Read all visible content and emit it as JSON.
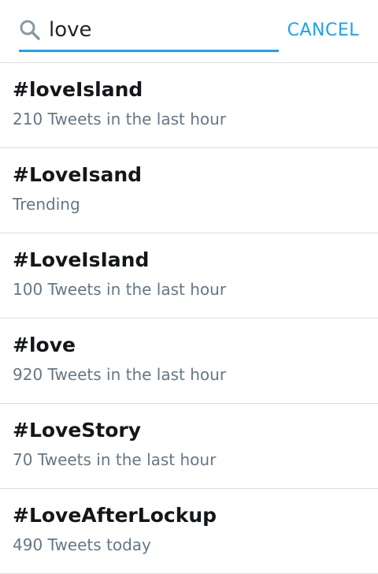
{
  "search": {
    "query": "love",
    "cancel_label": "CANCEL",
    "icon": "search-icon",
    "accent_color": "#1da1f2"
  },
  "trends": [
    {
      "hashtag": "#loveIsland",
      "meta": "210 Tweets in the last hour"
    },
    {
      "hashtag": "#LoveIsand",
      "meta": "Trending"
    },
    {
      "hashtag": "#LoveIsIand",
      "meta": "100 Tweets in the last hour"
    },
    {
      "hashtag": "#love",
      "meta": "920 Tweets in the last hour"
    },
    {
      "hashtag": "#LoveStory",
      "meta": "70 Tweets in the last hour"
    },
    {
      "hashtag": "#LoveAfterLockup",
      "meta": "490 Tweets today"
    }
  ]
}
